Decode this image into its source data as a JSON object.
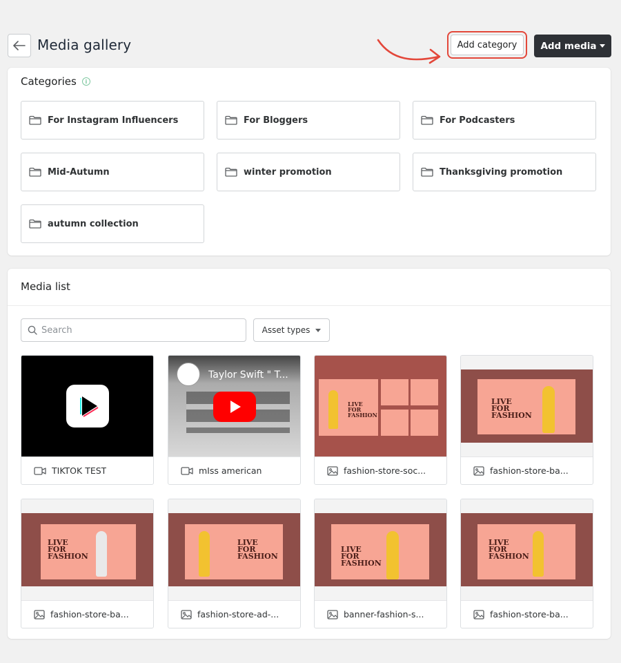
{
  "header": {
    "title": "Media gallery",
    "add_category_label": "Add category",
    "add_media_label": "Add media"
  },
  "categories": {
    "title": "Categories",
    "items": [
      {
        "label": "For Instagram Influencers"
      },
      {
        "label": "For Bloggers"
      },
      {
        "label": "For Podcasters"
      },
      {
        "label": "Mid-Autumn"
      },
      {
        "label": "winter promotion"
      },
      {
        "label": "Thanksgiving promotion"
      },
      {
        "label": "autumn collection"
      }
    ]
  },
  "media_list": {
    "title": "Media list",
    "search_placeholder": "Search",
    "asset_types_label": "Asset types",
    "items": [
      {
        "name": "TIKTOK TEST",
        "type": "video"
      },
      {
        "name": "mIss american",
        "type": "video",
        "thumb_text": "Taylor Swift \" T..."
      },
      {
        "name": "fashion-store-soc...",
        "type": "image"
      },
      {
        "name": "fashion-store-ba...",
        "type": "image"
      },
      {
        "name": "fashion-store-ba...",
        "type": "image"
      },
      {
        "name": "fashion-store-ad-...",
        "type": "image"
      },
      {
        "name": "banner-fashion-s...",
        "type": "image"
      },
      {
        "name": "fashion-store-ba...",
        "type": "image"
      }
    ],
    "poster_text": "LIVE FOR FASHION"
  },
  "colors": {
    "accent_red": "#e3473a",
    "primary_dark": "#2e3136",
    "poster_band": "#8e4e49",
    "poster_pink": "#f7a594"
  }
}
